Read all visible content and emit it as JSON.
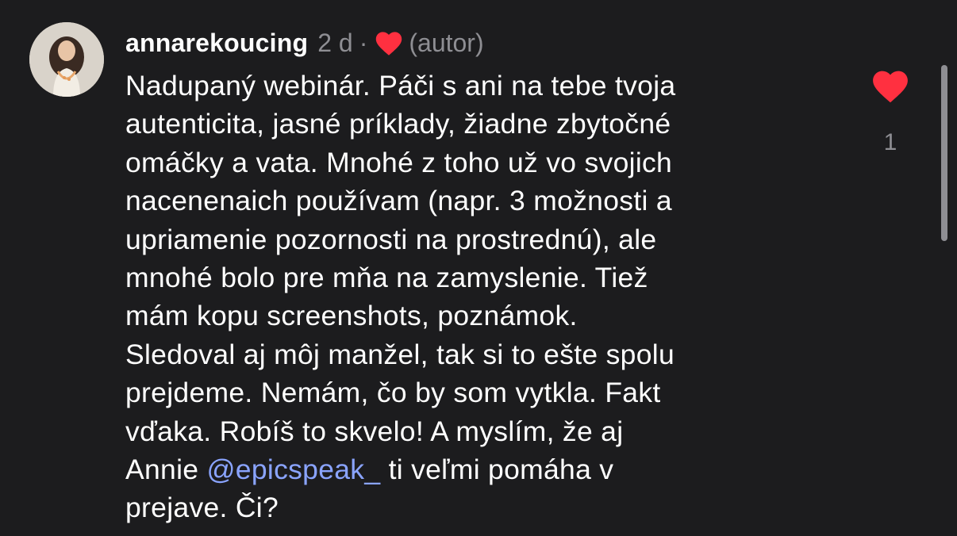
{
  "comment": {
    "username": "annarekoucing",
    "time": "2 d",
    "separator": "·",
    "author_tag": "(autor)",
    "author_heart_icon": "heart-icon",
    "lines": [
      "Nadupaný webinár. Páči s ani na tebe tvoja",
      "autenticita, jasné príklady, žiadne zbytočné",
      "omáčky a vata. Mnohé z toho už vo svojich",
      "nacenenaich používam (napr. 3 možnosti a",
      "upriamenie pozornosti na prostrednú), ale",
      "mnohé bolo pre mňa na zamyslenie. Tiež",
      "mám kopu screenshots, poznámok.",
      "Sledoval aj môj manžel, tak si to ešte spolu",
      "prejdeme. Nemám, čo by som vytkla. Fakt",
      "vďaka. Robíš to skvelo! A myslím, že aj"
    ],
    "mention_line": {
      "before": "Annie ",
      "mention": "@epicspeak_",
      "after": " ti veľmi pomáha v"
    },
    "last_line": "prejave. Či?",
    "like_icon": "heart-icon",
    "like_count": "1"
  },
  "colors": {
    "background": "#1c1c1e",
    "text": "#ffffff",
    "secondary": "#8e8e93",
    "like_red": "#ff3040",
    "mention": "#8aa4ff"
  }
}
